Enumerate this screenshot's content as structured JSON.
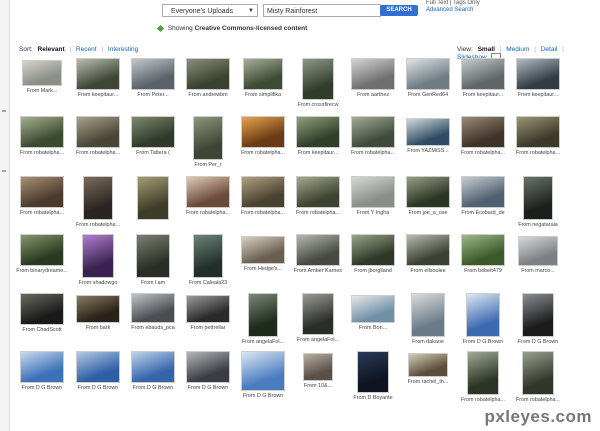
{
  "search": {
    "scope_value": "Everyone's Uploads",
    "query_value": "Misty Rainforest",
    "button_label": "SEARCH",
    "link_tips": "Full Text | Tags Only",
    "link_advanced": "Advanced Search"
  },
  "license_bar": {
    "prefix": "Showing",
    "highlight": "Creative Commons-licensed content"
  },
  "sort": {
    "label": "Sort:",
    "options": [
      "Relevant",
      "Recent",
      "Interesting"
    ],
    "active": "Relevant"
  },
  "view": {
    "label": "View:",
    "options": [
      "Small",
      "Medium",
      "Detail",
      "Slideshow"
    ],
    "active": "Small"
  },
  "photos": [
    {
      "caption": "From Mark...",
      "colors": [
        "#8a8f88",
        "#d7d3c8"
      ]
    },
    {
      "caption": "From keepitaur...",
      "colors": [
        "#3d4735",
        "#b9bcb0"
      ]
    },
    {
      "caption": "From Peter...",
      "colors": [
        "#59626a",
        "#c3c8cc"
      ]
    },
    {
      "caption": "From andrewbm",
      "colors": [
        "#39422e",
        "#8a8f7c"
      ]
    },
    {
      "caption": "From simplifika",
      "colors": [
        "#3d4a34",
        "#a7ae9a"
      ]
    },
    {
      "caption": "From crossfirecw",
      "colors": [
        "#2f3c28",
        "#8f9886"
      ]
    },
    {
      "caption": "From aarthez",
      "colors": [
        "#6f6f6f",
        "#d5d5d5"
      ]
    },
    {
      "caption": "From GenRed64",
      "colors": [
        "#707c84",
        "#dfe4e6"
      ]
    },
    {
      "caption": "From keepitaur...",
      "colors": [
        "#5e6668",
        "#c7cbcb"
      ]
    },
    {
      "caption": "From keepitaur...",
      "colors": [
        "#323c44",
        "#b0bcc4"
      ]
    },
    {
      "caption": "From robatelpha...",
      "colors": [
        "#3c4a30",
        "#a4b08e"
      ]
    },
    {
      "caption": "From robatelpha...",
      "colors": [
        "#4a4536",
        "#a9a28a"
      ]
    },
    {
      "caption": "From Tattera (",
      "colors": [
        "#2f3a2a",
        "#7d8a6e"
      ]
    },
    {
      "caption": "From Per_r",
      "colors": [
        "#3d4534",
        "#8d957d"
      ]
    },
    {
      "caption": "From robatelpha...",
      "colors": [
        "#6a3a14",
        "#e6a44c"
      ]
    },
    {
      "caption": "From keepitaur...",
      "colors": [
        "#2f3f2a",
        "#90a078"
      ]
    },
    {
      "caption": "From robatelpha...",
      "colors": [
        "#3e4a3a",
        "#a4ac98"
      ]
    },
    {
      "caption": "From YAZMiSS...",
      "colors": [
        "#304c64",
        "#d0d8de"
      ]
    },
    {
      "caption": "From robatelpha...",
      "colors": [
        "#3e3328",
        "#9a8a76"
      ]
    },
    {
      "caption": "From robatelpha...",
      "colors": [
        "#3d3a2a",
        "#9c9576"
      ]
    },
    {
      "caption": "From robatelpha...",
      "colors": [
        "#4a3a2c",
        "#a99274"
      ]
    },
    {
      "caption": "From robatelpha...",
      "colors": [
        "#2a2522",
        "#7a6a5a"
      ]
    },
    {
      "caption": "",
      "colors": [
        "#3c3c28",
        "#a49c70"
      ]
    },
    {
      "caption": "From robatelpha...",
      "colors": [
        "#6a4a38",
        "#e0cbb6"
      ]
    },
    {
      "caption": "From robatelpha...",
      "colors": [
        "#4a4030",
        "#b0a280"
      ]
    },
    {
      "caption": "From robatelpha...",
      "colors": [
        "#3e4230",
        "#a4a98e"
      ]
    },
    {
      "caption": "From Y Ingha",
      "colors": [
        "#8a8e88",
        "#d6d9d4"
      ]
    },
    {
      "caption": "From joe_a_ose",
      "colors": [
        "#2c3424",
        "#96a084"
      ]
    },
    {
      "caption": "From Ecobard_de",
      "colors": [
        "#4f6070",
        "#c4ccd0"
      ]
    },
    {
      "caption": "From negataraia",
      "colors": [
        "#1c201c",
        "#6a726a"
      ]
    },
    {
      "caption": "From binarydreame...",
      "colors": [
        "#2a3a22",
        "#84986e"
      ]
    },
    {
      "caption": "From shadowgo",
      "colors": [
        "#3a2250",
        "#b07ed0"
      ]
    },
    {
      "caption": "From l.am",
      "colors": [
        "#2a2e26",
        "#7a8070"
      ]
    },
    {
      "caption": "From Caleala23",
      "colors": [
        "#22302c",
        "#6c8478"
      ]
    },
    {
      "caption": "From Hedge's...",
      "colors": [
        "#6a5e50",
        "#d8d0c4"
      ]
    },
    {
      "caption": "From Amber Karnes",
      "colors": [
        "#464a40",
        "#b6b8ae"
      ]
    },
    {
      "caption": "From jborglland",
      "colors": [
        "#2e3828",
        "#9aa488"
      ]
    },
    {
      "caption": "From ellsoulee",
      "colors": [
        "#3a4034",
        "#b8bcb0"
      ]
    },
    {
      "caption": "From bobeit479",
      "colors": [
        "#3a5a2a",
        "#a0b88c"
      ]
    },
    {
      "caption": "From marco...",
      "colors": [
        "#7c8084",
        "#d8dadc"
      ]
    },
    {
      "caption": "From ChadScott",
      "colors": [
        "#1a1a1a",
        "#6a6a62"
      ]
    },
    {
      "caption": "From bark",
      "colors": [
        "#2a2218",
        "#8a7a64"
      ]
    },
    {
      "caption": "From ebauds_pca",
      "colors": [
        "#4a4e52",
        "#c0c4c6"
      ]
    },
    {
      "caption": "From pettrellar",
      "colors": [
        "#2a2a2a",
        "#9a9a9a"
      ]
    },
    {
      "caption": "From angelaFol...",
      "colors": [
        "#1e2a1c",
        "#7a8874"
      ]
    },
    {
      "caption": "From angelaFol...",
      "colors": [
        "#2a2e28",
        "#989c94"
      ]
    },
    {
      "caption": "From Bon...",
      "colors": [
        "#7090a8",
        "#e4e8ea"
      ]
    },
    {
      "caption": "From dakaoe",
      "colors": [
        "#6a7c88",
        "#dadcdc"
      ]
    },
    {
      "caption": "From D G Brown",
      "colors": [
        "#3c6ab0",
        "#dde6f2"
      ]
    },
    {
      "caption": "From D G Brown",
      "colors": [
        "#1c1c1c",
        "#8a8e94"
      ]
    },
    {
      "caption": "From D G Brown",
      "colors": [
        "#3c70b8",
        "#c8d8ec"
      ]
    },
    {
      "caption": "From D G Brown",
      "colors": [
        "#2e5ea6",
        "#b4c8e2"
      ]
    },
    {
      "caption": "From D G Brown",
      "colors": [
        "#3464aa",
        "#c0d2ea"
      ]
    },
    {
      "caption": "From D G Brown",
      "colors": [
        "#3a3e44",
        "#b4b6b8"
      ]
    },
    {
      "caption": "From D G Brown",
      "colors": [
        "#4a7cc0",
        "#dce6f2"
      ]
    },
    {
      "caption": "From 10&...",
      "colors": [
        "#5a5048",
        "#b8aea0"
      ]
    },
    {
      "caption": "From D Boyante",
      "colors": [
        "#0e1420",
        "#2a3a58"
      ]
    },
    {
      "caption": "From rachel_th...",
      "colors": [
        "#5a4e3a",
        "#d4ccb8"
      ]
    },
    {
      "caption": "From robatelpha...",
      "colors": [
        "#2c3426",
        "#a0aa94"
      ]
    },
    {
      "caption": "From robatelpha...",
      "colors": [
        "#30362a",
        "#98a08c"
      ]
    }
  ],
  "watermark": {
    "text": "pxleyes.com"
  }
}
